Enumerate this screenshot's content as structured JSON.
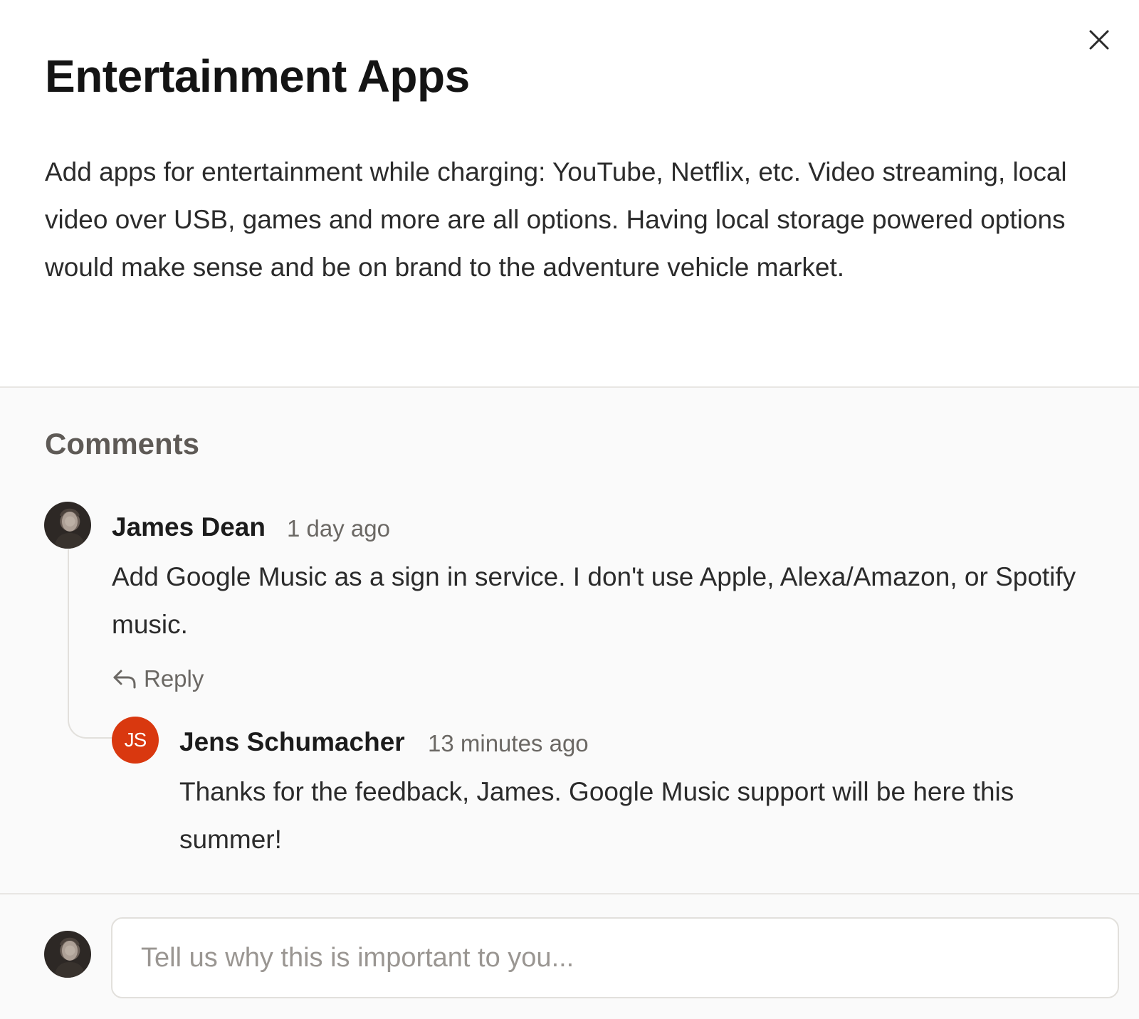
{
  "modal": {
    "title": "Entertainment Apps",
    "description": "Add apps for entertainment while charging: YouTube, Netflix, etc. Video streaming, local video over USB, games and more are all options. Having local storage powered options would make sense and be on brand to the adventure vehicle market.",
    "close_icon": "close-icon"
  },
  "comments": {
    "heading": "Comments",
    "items": [
      {
        "author": "James Dean",
        "timestamp": "1 day ago",
        "body": "Add Google Music as a sign in service. I don't use Apple, Alexa/Amazon, or Spotify music.",
        "reply_label": "Reply",
        "avatar_icon": "user-photo-avatar",
        "replies": [
          {
            "author": "Jens Schumacher",
            "timestamp": "13 minutes ago",
            "body": "Thanks for the feedback, James. Google Music support will be here this summer!",
            "initials": "JS",
            "avatar_color": "#d9380f"
          }
        ]
      }
    ]
  },
  "composer": {
    "placeholder": "Tell us why this is important to you...",
    "value": "",
    "avatar_icon": "user-photo-avatar"
  },
  "colors": {
    "accent_avatar": "#d9380f",
    "section_background": "#fafafa",
    "border": "#e2e0dc"
  }
}
